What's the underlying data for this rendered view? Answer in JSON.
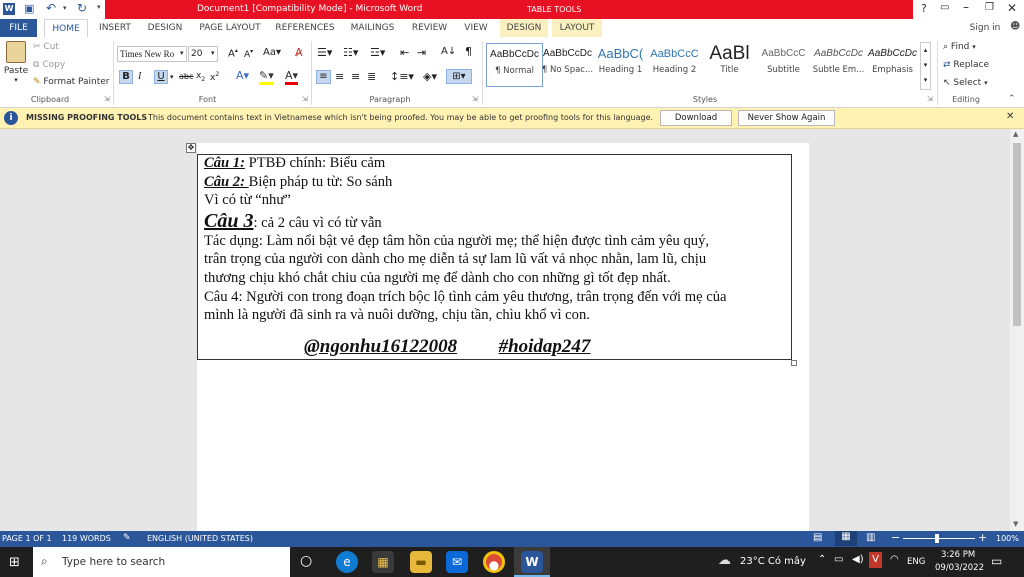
{
  "title_bar": {
    "title": "Document1 [Compatibility Mode] - Microsoft Word",
    "context_tab_group": "TABLE TOOLS"
  },
  "ribbon_tabs": [
    "FILE",
    "HOME",
    "INSERT",
    "DESIGN",
    "PAGE LAYOUT",
    "REFERENCES",
    "MAILINGS",
    "REVIEW",
    "VIEW",
    "DESIGN",
    "LAYOUT"
  ],
  "sign_in": "Sign in",
  "clipboard": {
    "paste": "Paste",
    "cut": "Cut",
    "copy": "Copy",
    "format_painter": "Format Painter",
    "label": "Clipboard"
  },
  "font": {
    "name": "Times New Ro",
    "size": "20",
    "label": "Font"
  },
  "paragraph": {
    "label": "Paragraph"
  },
  "styles": {
    "label": "Styles",
    "items": [
      {
        "sample": "AaBbCcDc",
        "name": "¶ Normal"
      },
      {
        "sample": "AaBbCcDc",
        "name": "¶ No Spac..."
      },
      {
        "sample": "AaBbC(",
        "name": "Heading 1"
      },
      {
        "sample": "AaBbCcC",
        "name": "Heading 2"
      },
      {
        "sample": "AaBl",
        "name": "Title"
      },
      {
        "sample": "AaBbCcC",
        "name": "Subtitle"
      },
      {
        "sample": "AaBbCcDc",
        "name": "Subtle Em..."
      },
      {
        "sample": "AaBbCcDc",
        "name": "Emphasis"
      }
    ]
  },
  "editing": {
    "find": "Find",
    "replace": "Replace",
    "select": "Select",
    "label": "Editing"
  },
  "message_bar": {
    "title": "MISSING PROOFING TOOLS",
    "text": "This document contains text in Vietnamese which isn't being proofed. You may be able to get proofing tools for this language.",
    "download": "Download",
    "never_show": "Never Show Again"
  },
  "document": {
    "cau1_label": "Câu 1:",
    "cau1_text": "  PTBĐ chính: Biểu cảm",
    "cau2_label": "Câu 2: ",
    "cau2_text": " Biện pháp tu từ: So sánh",
    "cau2_reason": " Vì có từ “như”",
    "cau3_label": "Câu 3",
    "cau3_text": ":  cả 2 câu vì có từ vẫn",
    "tacdung_1": "Tác dụng: Làm nổi bật vẻ đẹp tâm hồn của người mẹ; thể hiện được tình cảm yêu quý,",
    "tacdung_2": "trân trọng của người con dành cho mẹ diễn tả sự lam lũ vất vả nhọc nhằn, lam lũ, chịu",
    "tacdung_3": "thương chịu khó chắt chiu của người mẹ để dành cho con những gì tốt đẹp nhất.",
    "cau4_1": "Câu 4:  Người con trong đoạn trích bộc lộ tình cảm yêu thương, trân trọng đến với mẹ của",
    "cau4_2": "mình là người đã sinh ra và nuôi dưỡng, chịu tần, chìu khổ vì con.",
    "signature_left": "@ngonhu16122008",
    "signature_right": " #hoidap247"
  },
  "status_bar": {
    "page": "PAGE 1 OF 1",
    "words": "119 WORDS",
    "language": "ENGLISH (UNITED STATES)",
    "zoom": "100%"
  },
  "taskbar": {
    "search_placeholder": "Type here to search",
    "weather": "23°C  Có mây",
    "lang": "ENG",
    "time": "3:26 PM",
    "date": "09/03/2022"
  },
  "colors": {
    "brand": "#2b579a",
    "title_red": "#e81123",
    "msg_bg": "#fff2b3"
  }
}
